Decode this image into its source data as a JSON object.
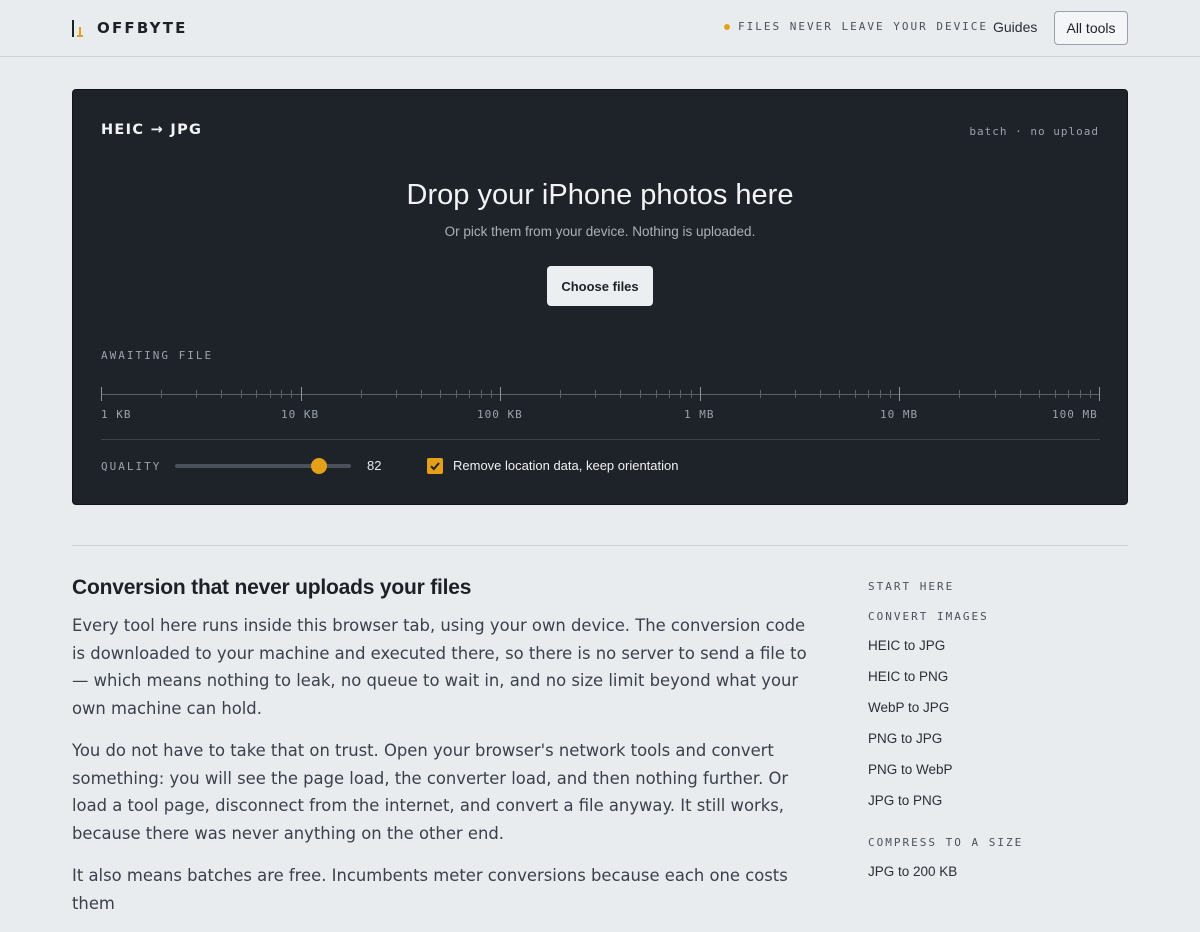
{
  "header": {
    "brand_name": "OFFBYTE",
    "privacy_note": "FILES NEVER LEAVE YOUR DEVICE",
    "nav_guides": "Guides",
    "nav_all_tools": "All tools"
  },
  "tool": {
    "title": "HEIC → JPG",
    "meta": "batch · no upload",
    "drop_heading": "Drop your iPhone photos here",
    "drop_subtext": "Or pick them from your device. Nothing is uploaded.",
    "choose_button": "Choose files",
    "status": "AWAITING FILE",
    "size_scale": {
      "labels": [
        "1 KB",
        "10 KB",
        "100 KB",
        "1 MB",
        "10 MB",
        "100 MB"
      ],
      "scale": "log"
    },
    "quality_label": "QUALITY",
    "quality_value": "82",
    "quality_range": [
      0,
      100
    ],
    "strip_location_checked": true,
    "strip_location_label": "Remove location data, keep orientation"
  },
  "colors": {
    "accent": "#e5a019",
    "panel_bg": "#1e232a",
    "page_bg": "#e8ecef"
  },
  "article": {
    "heading": "Conversion that never uploads your files",
    "paragraphs": [
      "Every tool here runs inside this browser tab, using your own device. The conversion code is downloaded to your machine and executed there, so there is no server to send a file to — which means nothing to leak, no queue to wait in, and no size limit beyond what your own machine can hold.",
      "You do not have to take that on trust. Open your browser's network tools and convert something: you will see the page load, the converter load, and then nothing further. Or load a tool page, disconnect from the internet, and convert a file anyway. It still works, because there was never anything on the other end.",
      "It also means batches are free. Incumbents meter conversions because each one costs them"
    ]
  },
  "sidenav": {
    "start_here": "START HERE",
    "convert_images_heading": "CONVERT IMAGES",
    "convert_links": [
      "HEIC to JPG",
      "HEIC to PNG",
      "WebP to JPG",
      "PNG to JPG",
      "PNG to WebP",
      "JPG to PNG"
    ],
    "compress_heading": "COMPRESS TO A SIZE",
    "compress_links": [
      "JPG to 200 KB"
    ]
  }
}
